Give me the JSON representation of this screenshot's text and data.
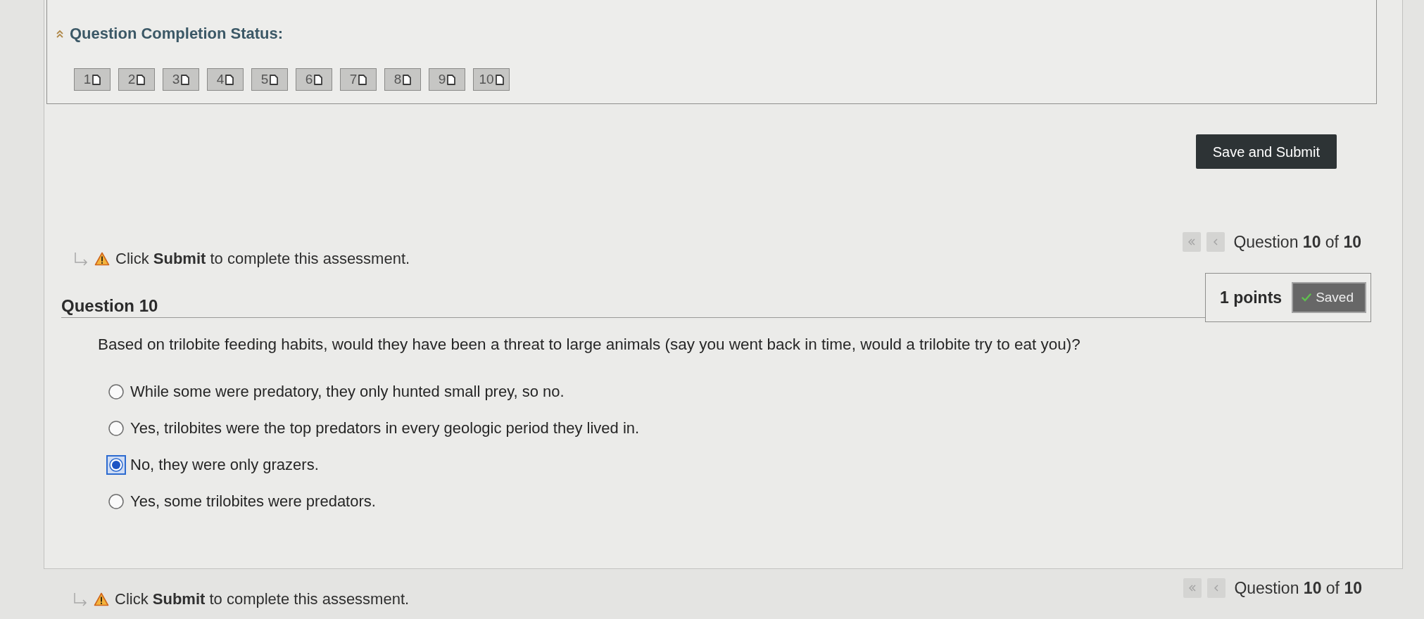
{
  "status_panel": {
    "title": "Question Completion Status:",
    "questions": [
      "1",
      "2",
      "3",
      "4",
      "5",
      "6",
      "7",
      "8",
      "9",
      "10"
    ]
  },
  "save_button": "Save and Submit",
  "top_bar": {
    "instruction": "Click **Submit** to complete this assessment.",
    "navigation": {
      "buttons": [
        {
          "kind": "first",
          "disabled": true
        },
        {
          "kind": "previous",
          "disabled": true
        }
      ],
      "label": "Question **10** of **10**"
    }
  },
  "question": {
    "title": "Question 10",
    "points": "1 points",
    "save_status": "Saved",
    "text": "Based on trilobite feeding habits, would they have been a threat to large animals (say you went back in time, would a trilobite try to eat you)?",
    "options": [
      {
        "text": "While some were predatory, they only hunted small prey, so no.",
        "selected": false
      },
      {
        "text": "Yes, trilobites were the top predators in every geologic period they lived in.",
        "selected": false
      },
      {
        "text": "No, they were only grazers.",
        "selected": true
      },
      {
        "text": "Yes, some trilobites were predators.",
        "selected": false
      }
    ]
  },
  "bottom_bar": {
    "instruction": "Click **Submit** to complete this assessment.",
    "navigation": {
      "buttons": [
        {
          "kind": "first",
          "disabled": true
        },
        {
          "kind": "previous",
          "disabled": true
        }
      ],
      "label": "Question **10** of **10**"
    }
  }
}
